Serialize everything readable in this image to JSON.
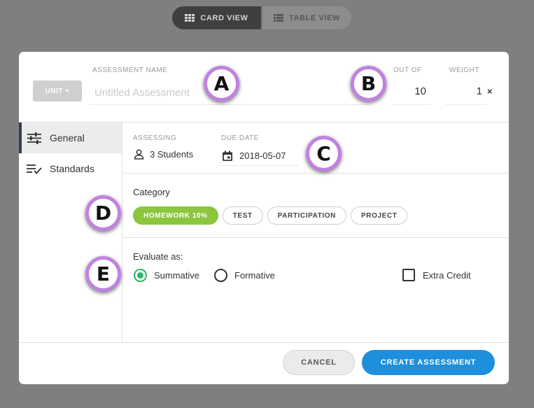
{
  "view_toggle": {
    "card_label": "CARD VIEW",
    "table_label": "TABLE VIEW",
    "active": "card",
    "card_icon": "grid-icon",
    "table_icon": "list-icon"
  },
  "header": {
    "unit_button": "UNIT +",
    "name_label": "ASSESSMENT NAME",
    "name_placeholder": "Untitled Assessment",
    "name_value": "",
    "outof_label": "OUT OF",
    "outof_value": "10",
    "weight_label": "WEIGHT",
    "weight_value": "1",
    "weight_clear": "×"
  },
  "sidebar": {
    "items": [
      {
        "label": "General",
        "icon": "sliders-icon",
        "active": true
      },
      {
        "label": "Standards",
        "icon": "checklist-icon",
        "active": false
      }
    ]
  },
  "assessing": {
    "label": "ASSESSING",
    "value": "3 Students",
    "icon": "person-icon"
  },
  "due_date": {
    "label": "DUE DATE",
    "value": "2018-05-07",
    "icon": "calendar-icon"
  },
  "category": {
    "title": "Category",
    "chips": [
      {
        "label": "HOMEWORK 10%",
        "selected": true
      },
      {
        "label": "TEST",
        "selected": false
      },
      {
        "label": "PARTICIPATION",
        "selected": false
      },
      {
        "label": "PROJECT",
        "selected": false
      }
    ]
  },
  "evaluate": {
    "title": "Evaluate as:",
    "options": [
      {
        "label": "Summative",
        "selected": true
      },
      {
        "label": "Formative",
        "selected": false
      }
    ],
    "extra_credit_label": "Extra Credit",
    "extra_credit_checked": false
  },
  "footer": {
    "cancel_label": "CANCEL",
    "create_label": "CREATE ASSESSMENT"
  },
  "markers": [
    "A",
    "B",
    "C",
    "D",
    "E"
  ],
  "colors": {
    "accent_green": "#8cc63f",
    "radio_green": "#2fb36b",
    "primary_blue": "#1d8fdc",
    "marker_ring": "#c182e0",
    "backdrop": "#7f7f7f"
  }
}
